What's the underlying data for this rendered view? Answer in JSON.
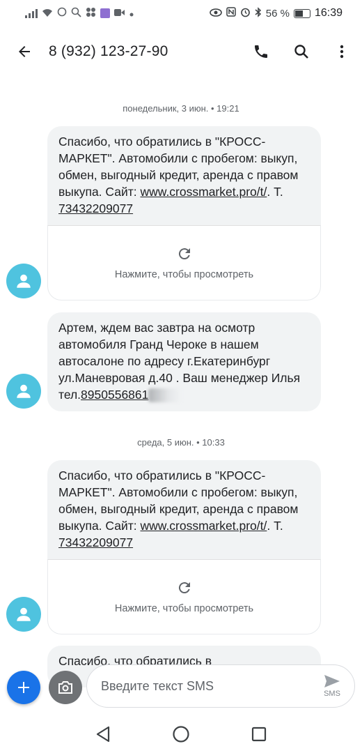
{
  "status_bar": {
    "battery_percent": "56 %",
    "time": "16:39"
  },
  "header": {
    "title": "8 (932) 123-27-90"
  },
  "conversation": {
    "date_stamps": [
      "понедельник, 3 июн. • 19:21",
      "среда, 5 июн. • 10:33"
    ],
    "messages": [
      {
        "text": "Спасибо, что обратились в \"КРОСС-МАРКЕТ\". Автомобили с пробегом: выкуп, обмен, выгодный кредит, аренда с правом выкупа. Сайт: ",
        "link": "www.crossmarket.pro/t/",
        "mid": ". Т.  ",
        "phone": "73432209077",
        "preview_label": "Нажмите, чтобы просмотреть"
      },
      {
        "text": "Артем, ждем вас завтра на осмотр автомобиля Гранд Чероке в нашем автосалоне по адресу г.Екатеринбург ул.Маневровая д.40 . Ваш менеджер Илья тел.",
        "phone_visible": "8950556861"
      },
      {
        "text": "Спасибо, что обратились в \"КРОСС-МАРКЕТ\". Автомобили с пробегом: выкуп, обмен, выгодный кредит, аренда с правом выкупа. Сайт: ",
        "link": "www.crossmarket.pro/t/",
        "mid": ". Т.  ",
        "phone": "73432209077",
        "preview_label": "Нажмите, чтобы просмотреть"
      },
      {
        "text": "Спасибо, что обратились в"
      }
    ]
  },
  "compose": {
    "placeholder": "Введите текст SMS",
    "send_label": "SMS"
  },
  "colors": {
    "avatar": "#4fc3df",
    "fab": "#1a73e8",
    "bubble": "#f1f3f4"
  }
}
